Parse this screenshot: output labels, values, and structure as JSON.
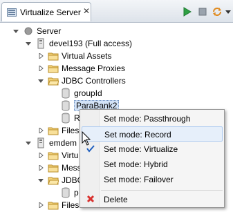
{
  "view": {
    "title": "Virtualize Server",
    "close_label": "✕"
  },
  "toolbar": {
    "run_icon": "run-icon",
    "stop_icon": "stop-icon",
    "refresh_icon": "refresh-icon",
    "menu_icon": "view-menu-icon"
  },
  "tree": {
    "server": "Server",
    "host1": "devel193 (Full access)",
    "virtual_assets": "Virtual Assets",
    "message_proxies": "Message Proxies",
    "jdbc_controllers": "JDBC Controllers",
    "group_id": "groupId",
    "parabank": "ParaBank2",
    "r_item": "R",
    "files1": "Files",
    "host2": "emdem",
    "virtu": "Virtu",
    "mess": "Mess",
    "jdbc": "JDBC",
    "p_item": "p",
    "files2": "Files"
  },
  "menu": {
    "items": [
      {
        "label": "Set mode: Passthrough"
      },
      {
        "label": "Set mode: Record"
      },
      {
        "label": "Set mode: Virtualize",
        "checked": true
      },
      {
        "label": "Set mode: Hybrid"
      },
      {
        "label": "Set mode: Failover"
      },
      {
        "label": "Delete"
      }
    ]
  }
}
